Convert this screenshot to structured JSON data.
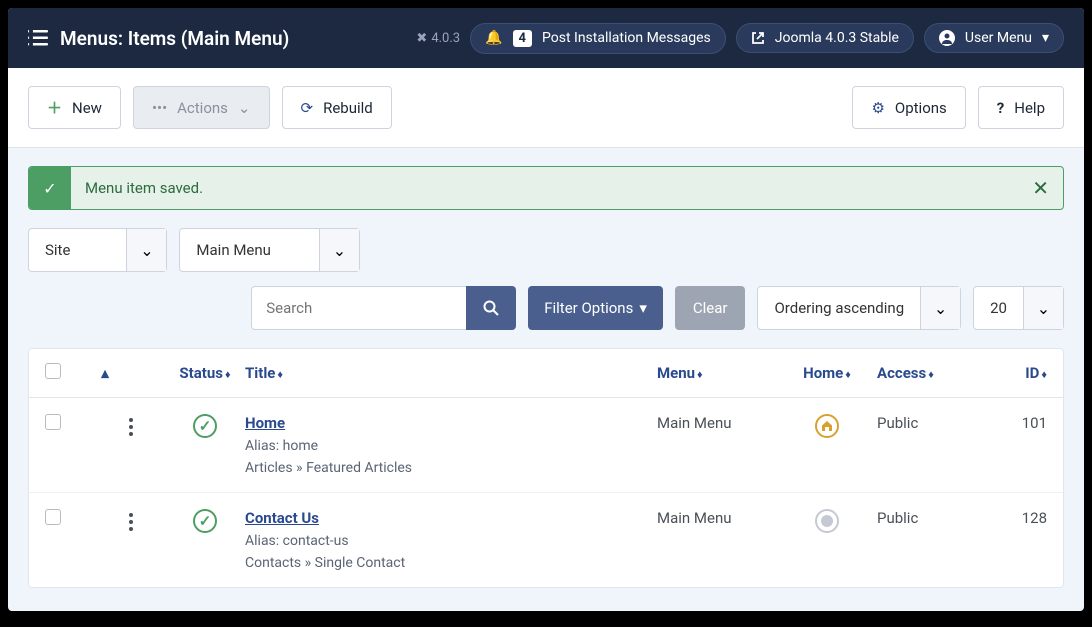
{
  "header": {
    "title": "Menus: Items (Main Menu)",
    "version": "4.0.3",
    "notif_count": "4",
    "notif_label": "Post Installation Messages",
    "system_label": "Joomla 4.0.3 Stable",
    "user_menu": "User Menu"
  },
  "toolbar": {
    "new_label": "New",
    "actions_label": "Actions",
    "rebuild_label": "Rebuild",
    "options_label": "Options",
    "help_label": "Help"
  },
  "alert": {
    "message": "Menu item saved."
  },
  "filters": {
    "client": "Site",
    "menu": "Main Menu",
    "search_placeholder": "Search",
    "filter_options": "Filter Options",
    "clear": "Clear",
    "ordering": "Ordering ascending",
    "limit": "20"
  },
  "columns": {
    "status": "Status",
    "title": "Title",
    "menu": "Menu",
    "home": "Home",
    "access": "Access",
    "id": "ID"
  },
  "rows": [
    {
      "title": "Home",
      "alias": "Alias: home",
      "path": "Articles » Featured Articles",
      "menu": "Main Menu",
      "access": "Public",
      "id": "101",
      "is_home": true
    },
    {
      "title": "Contact Us",
      "alias": "Alias: contact-us",
      "path": "Contacts » Single Contact",
      "menu": "Main Menu",
      "access": "Public",
      "id": "128",
      "is_home": false
    }
  ]
}
